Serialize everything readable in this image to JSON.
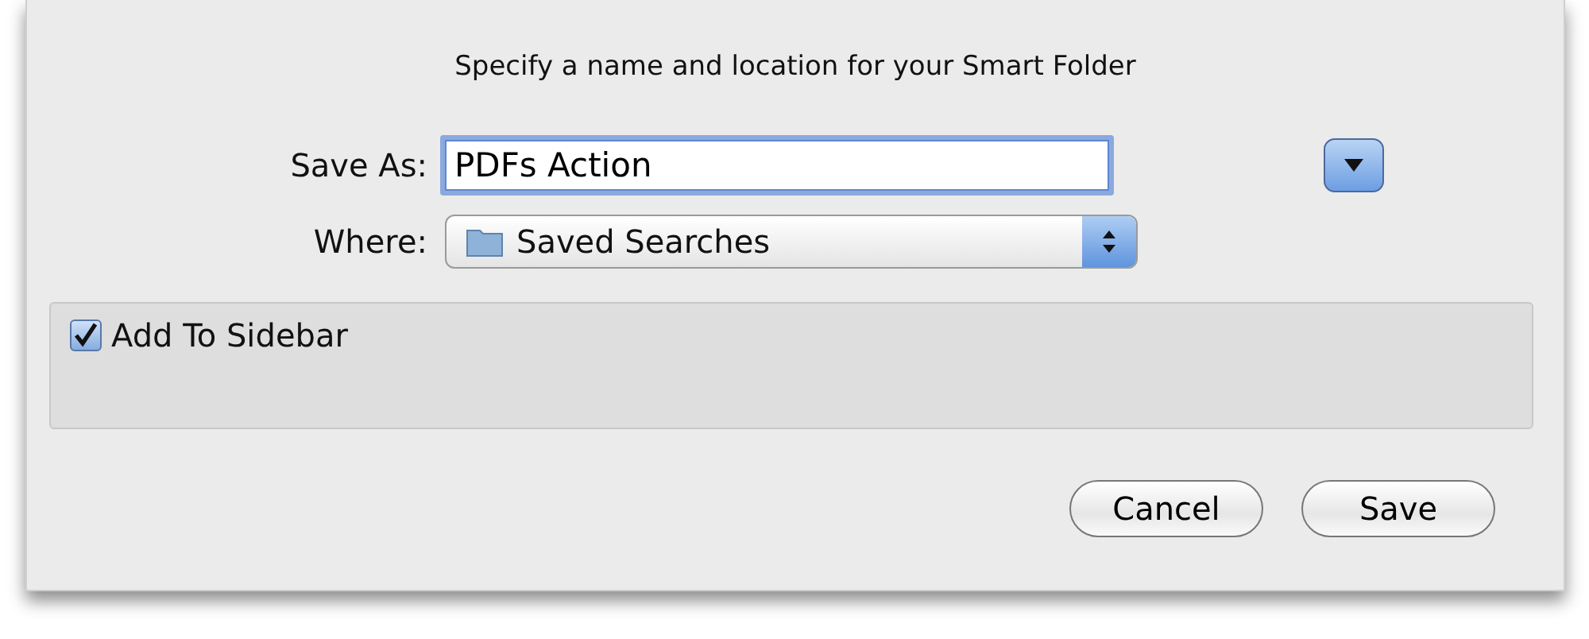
{
  "dialog": {
    "prompt": "Specify a name and location for your Smart Folder",
    "save_as": {
      "label": "Save As:",
      "value": "PDFs Action"
    },
    "where": {
      "label": "Where:",
      "value": "Saved Searches"
    },
    "options": [
      {
        "kind": "checkbox",
        "label": "Add To Sidebar",
        "checked": true
      }
    ],
    "buttons": [
      {
        "label": "Cancel"
      },
      {
        "label": "Save"
      }
    ]
  }
}
